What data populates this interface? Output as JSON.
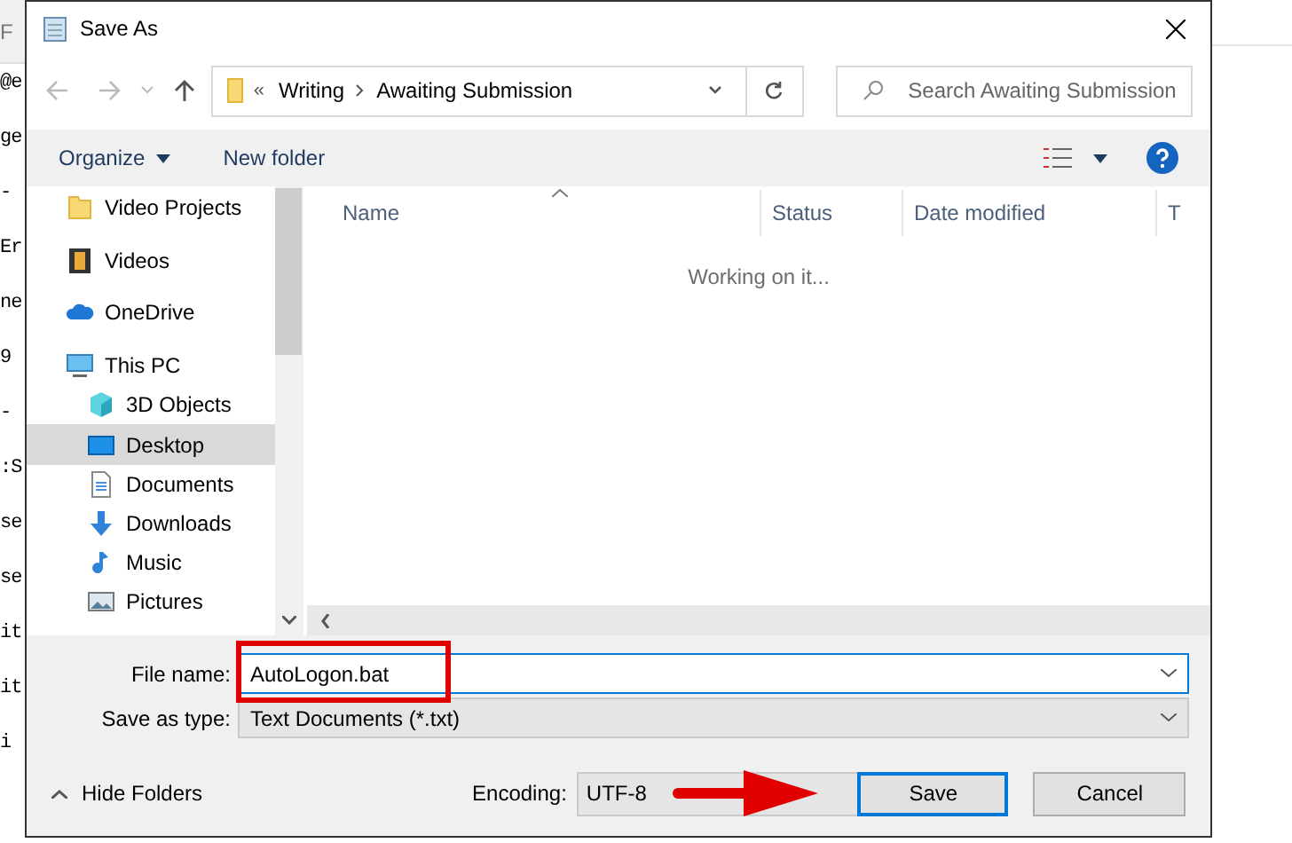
{
  "background_editor": {
    "menu_text": "F",
    "lines": [
      "@e",
      "ge",
      "-",
      "Er",
      "ne",
      "9",
      "-",
      ":S",
      "se",
      "se",
      "it",
      "it",
      "i"
    ]
  },
  "window": {
    "title": "Save As"
  },
  "address_bar": {
    "overflow": "«",
    "path": [
      "Writing",
      "Awaiting Submission"
    ]
  },
  "search": {
    "placeholder": "Search Awaiting Submission"
  },
  "toolbar": {
    "organize": "Organize",
    "new_folder": "New folder"
  },
  "sidebar": {
    "items": [
      {
        "children": [
          {
            "label": "Video Projects",
            "kind": "folder",
            "selected": false
          },
          {
            "label": "Videos",
            "kind": "videos",
            "selected": false
          }
        ]
      },
      {
        "label": "OneDrive",
        "kind": "cloud",
        "selected": false
      },
      {
        "label": "This PC",
        "kind": "pc",
        "selected": false,
        "children": [
          {
            "label": "3D Objects",
            "kind": "cube",
            "selected": false
          },
          {
            "label": "Desktop",
            "kind": "desktop",
            "selected": true
          },
          {
            "label": "Documents",
            "kind": "document",
            "selected": false
          },
          {
            "label": "Downloads",
            "kind": "download",
            "selected": false
          },
          {
            "label": "Music",
            "kind": "music",
            "selected": false
          },
          {
            "label": "Pictures",
            "kind": "pictures",
            "selected": false
          }
        ]
      }
    ]
  },
  "file_list": {
    "columns": [
      "Name",
      "Status",
      "Date modified",
      "T"
    ],
    "status": "Working on it..."
  },
  "form": {
    "file_name_label": "File name:",
    "file_name": "AutoLogon.bat",
    "type_label": "Save as type:",
    "type": "Text Documents (*.txt)",
    "encoding_label": "Encoding:",
    "encoding": "UTF-8"
  },
  "hide_folders": "Hide Folders",
  "buttons": {
    "save": "Save",
    "cancel": "Cancel"
  }
}
